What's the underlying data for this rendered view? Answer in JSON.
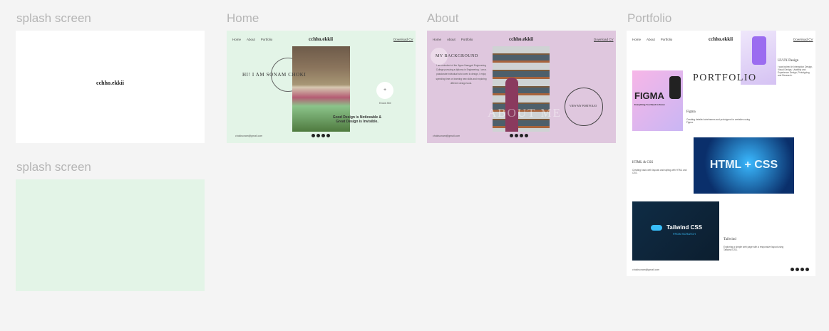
{
  "labels": {
    "splash1": "splash screen",
    "home": "Home",
    "about": "About",
    "portfolio": "Portfolio",
    "splash2": "splash screen"
  },
  "colors": {
    "canvas": "#f4f4f4",
    "home_bg": "#e3f4e7",
    "about_bg": "#dfc7de",
    "splash2_bg": "#e3f4e7",
    "white": "#ffffff"
  },
  "splash": {
    "logo": "cchho.ekkii"
  },
  "home": {
    "nav": [
      "Home",
      "About",
      "Portfolio"
    ],
    "logo": "cchho.ekkii",
    "download": "Download CV",
    "name": "HI! I AM SONAM CHOKI",
    "more": "+",
    "more_label": "Know Me",
    "quote": "Good Design is Noticeable & Great Design is Invisible.",
    "email": "chokisonam@gmail.com"
  },
  "about": {
    "nav": [
      "Home",
      "About",
      "Portfolio"
    ],
    "logo": "cchho.ekkii",
    "download": "Download CV",
    "heading": "MY BACKGROUND",
    "body": "I am a student of the Jigme Namgyel Engineering College pursuing a diploma in Engineering. I am a passionate individual who loves to design, I enjoy spending time on learning new skills and exploring different design tools.",
    "watermark": "ABOUT ME",
    "button": "VIEW MY PORTFOLIO",
    "email": "chokisonam@gmail.com"
  },
  "portfolio": {
    "nav": [
      "Home",
      "About",
      "Portfolio"
    ],
    "logo": "cchho.ekkii",
    "download": "Download CV",
    "title": "PORTFOLIO",
    "uiux_title": "UI/UX Design",
    "uiux_text": "I was trained in Interaction Design, Visual Design, Usability and Experience Design, Prototyping and Research.",
    "figma_img": "FIGMA",
    "figma_sub": "Everything You Need to Know",
    "figma_title": "Figma",
    "figma_text": "Creating detailed wireframes and prototypes for websites using Figma.",
    "html_title": "HTML & CSS",
    "html_text": "Creating basic web layouts and styling with HTML and CSS.",
    "html_img": "HTML + CSS",
    "tw_img": "Tailwind CSS",
    "tw_sub": "FROM SCRATCH",
    "tw_title": "Tailwind",
    "tw_text": "Exploring a simple web page with a responsive layout using Tailwind CSS.",
    "email": "chokisonam@gmail.com"
  }
}
